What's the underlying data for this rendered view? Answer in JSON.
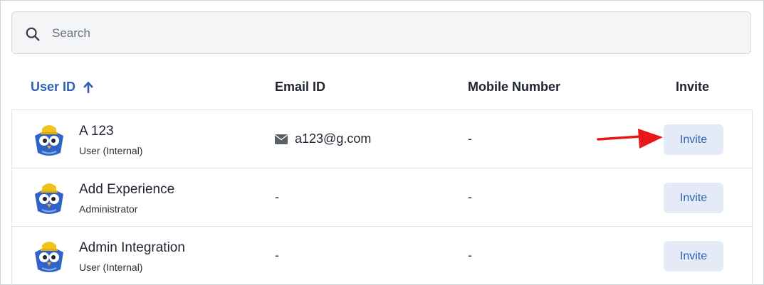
{
  "search": {
    "placeholder": "Search"
  },
  "table": {
    "headers": {
      "user_id": "User ID",
      "email": "Email ID",
      "mobile": "Mobile Number",
      "invite": "Invite"
    },
    "sort": "ascending",
    "rows": [
      {
        "name": "A 123",
        "role": "User (Internal)",
        "email": "a123@g.com",
        "mobile": "-",
        "invite": "Invite"
      },
      {
        "name": "Add Experience",
        "role": "Administrator",
        "email": "-",
        "mobile": "-",
        "invite": "Invite"
      },
      {
        "name": "Admin Integration",
        "role": "User (Internal)",
        "email": "-",
        "mobile": "-",
        "invite": "Invite"
      }
    ]
  },
  "colors": {
    "accent": "#2f5fb3",
    "button_bg": "#e5ebf6",
    "annotation_arrow": "#e8181a"
  },
  "icons": [
    "search-icon",
    "sort-up-arrow-icon",
    "owl-avatar-icon",
    "mail-icon",
    "red-arrow-annotation"
  ]
}
